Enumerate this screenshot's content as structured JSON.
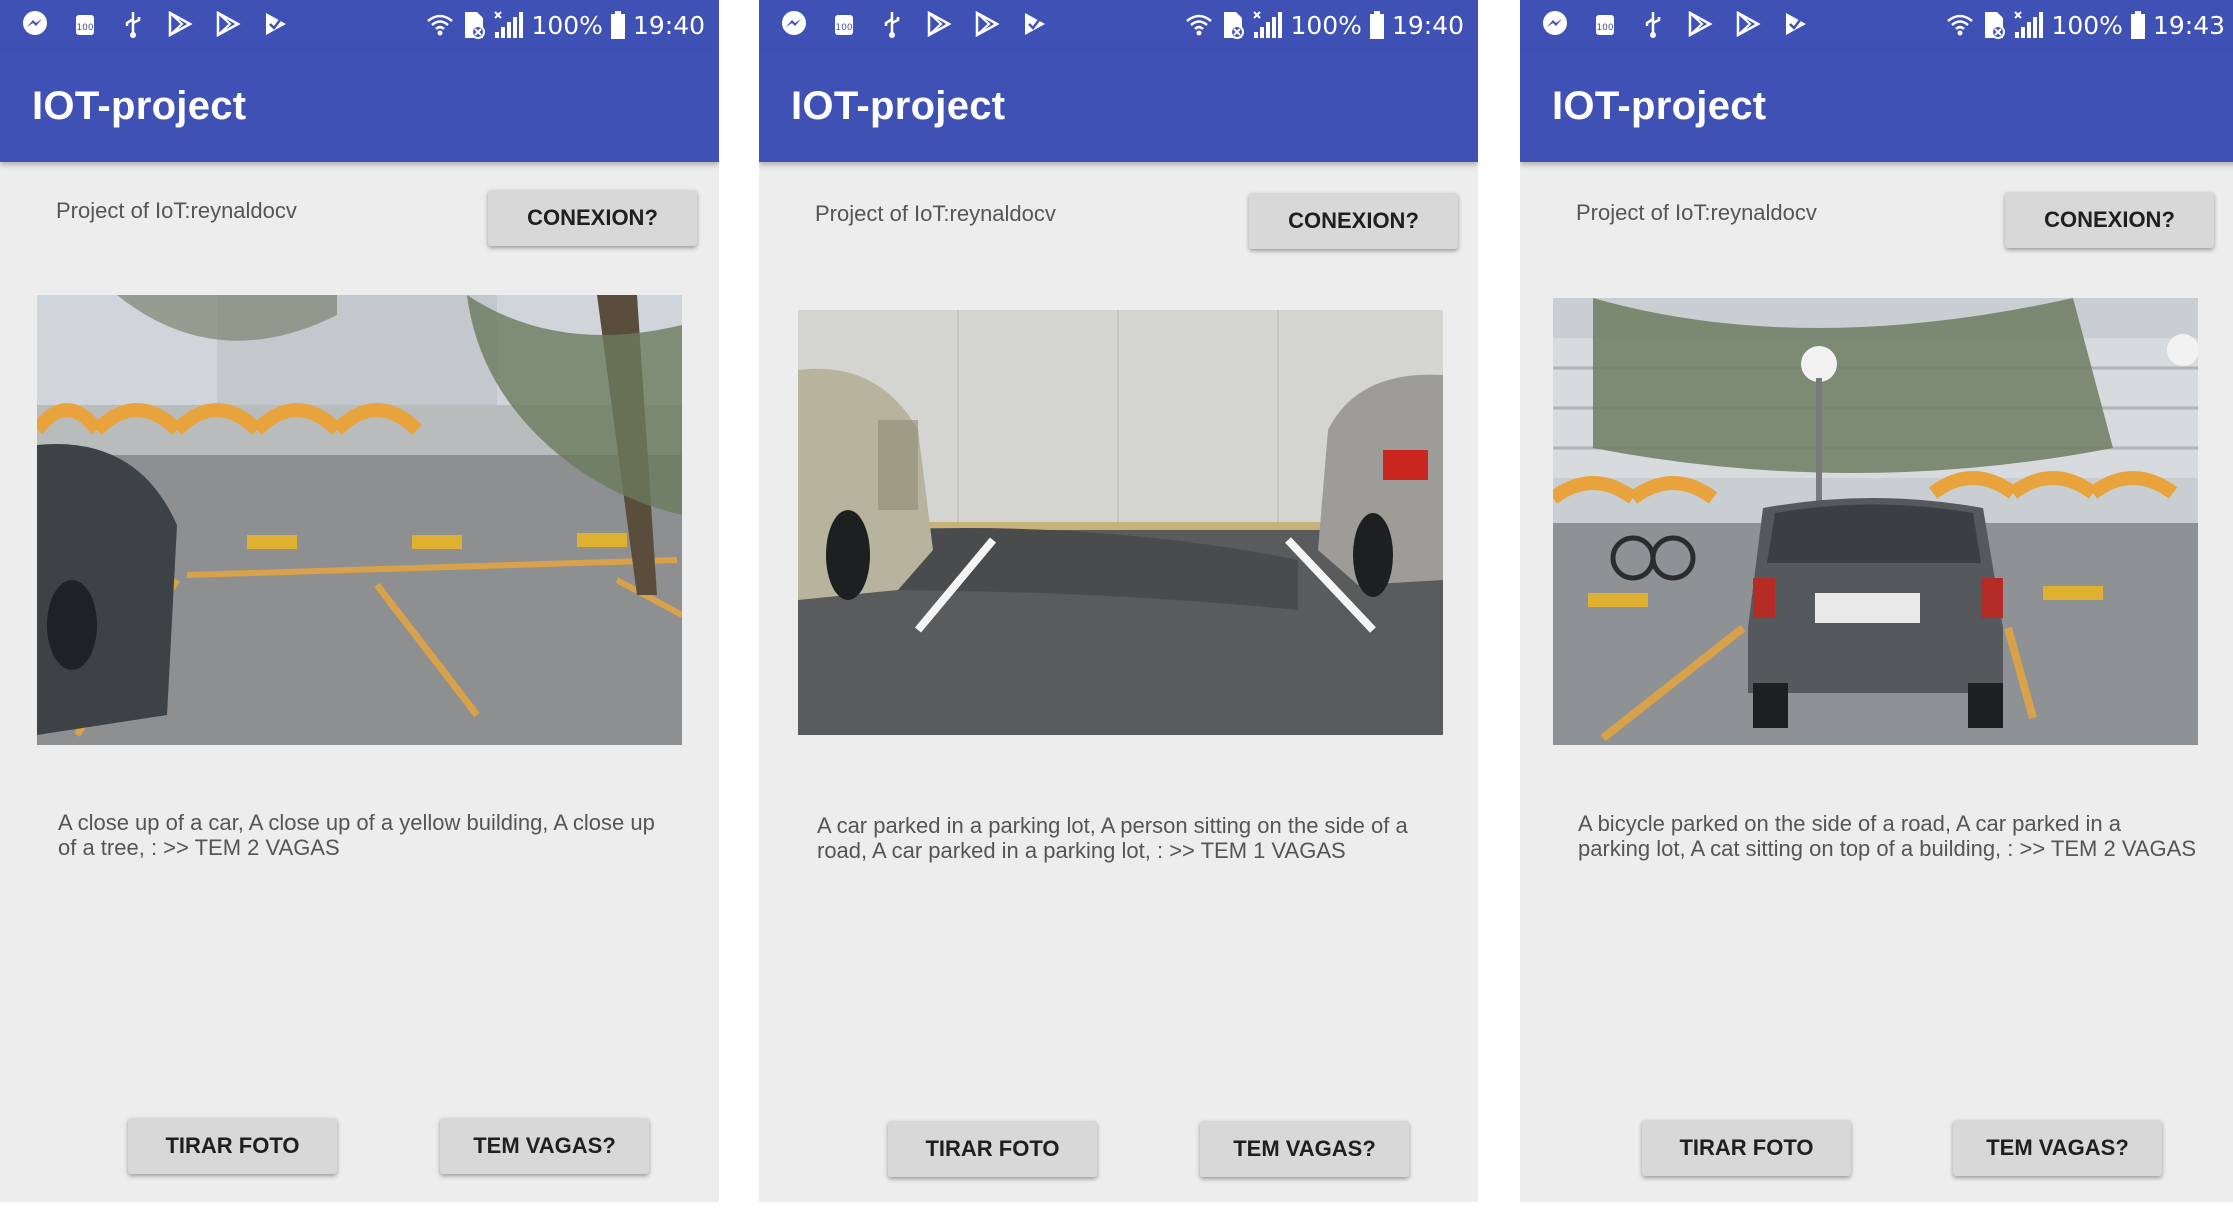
{
  "screens": [
    {
      "status": {
        "battery": "100%",
        "time": "19:40"
      },
      "app_title": "IOT-project",
      "project_label": "Project of IoT:reynaldocv",
      "connect_button": "CONEXION?",
      "photo": {
        "subject": "parking-lot-two-vacant-spaces"
      },
      "caption": "A close up of a car, A close up of a yellow building, A close up of a tree,  : >> TEM 2 VAGAS",
      "take_photo_button": "TIRAR FOTO",
      "vacancies_button": "TEM VAGAS?"
    },
    {
      "status": {
        "battery": "100%",
        "time": "19:40"
      },
      "app_title": "IOT-project",
      "project_label": "Project of IoT:reynaldocv",
      "connect_button": "CONEXION?",
      "photo": {
        "subject": "parking-space-between-two-cars"
      },
      "caption": "A car parked in a parking lot, A person sitting on the side of a road, A car parked in a parking lot,  : >> TEM 1 VAGAS",
      "take_photo_button": "TIRAR FOTO",
      "vacancies_button": "TEM VAGAS?"
    },
    {
      "status": {
        "battery": "100%",
        "time": "19:43"
      },
      "app_title": "IOT-project",
      "project_label": "Project of IoT:reynaldocv",
      "connect_button": "CONEXION?",
      "photo": {
        "subject": "car-parked-in-parking-lot"
      },
      "caption": "A bicycle parked on the side of a road, A car parked in a parking lot, A cat sitting on top of a building,  : >> TEM 2 VAGAS",
      "take_photo_button": "TIRAR FOTO",
      "vacancies_button": "TEM VAGAS?"
    }
  ],
  "colors": {
    "primary": "#3f51b5",
    "screen_background": "#ededed",
    "button": "#d8d8d8",
    "text": "#555555"
  },
  "icons": {
    "notifications": [
      "messenger-icon",
      "android-100-icon",
      "usb-icon",
      "play-store-icon",
      "play-store-icon",
      "play-store-check-icon"
    ],
    "status_right": [
      "wifi-icon",
      "sim-off-icon",
      "signal-icon",
      "battery-icon"
    ]
  }
}
